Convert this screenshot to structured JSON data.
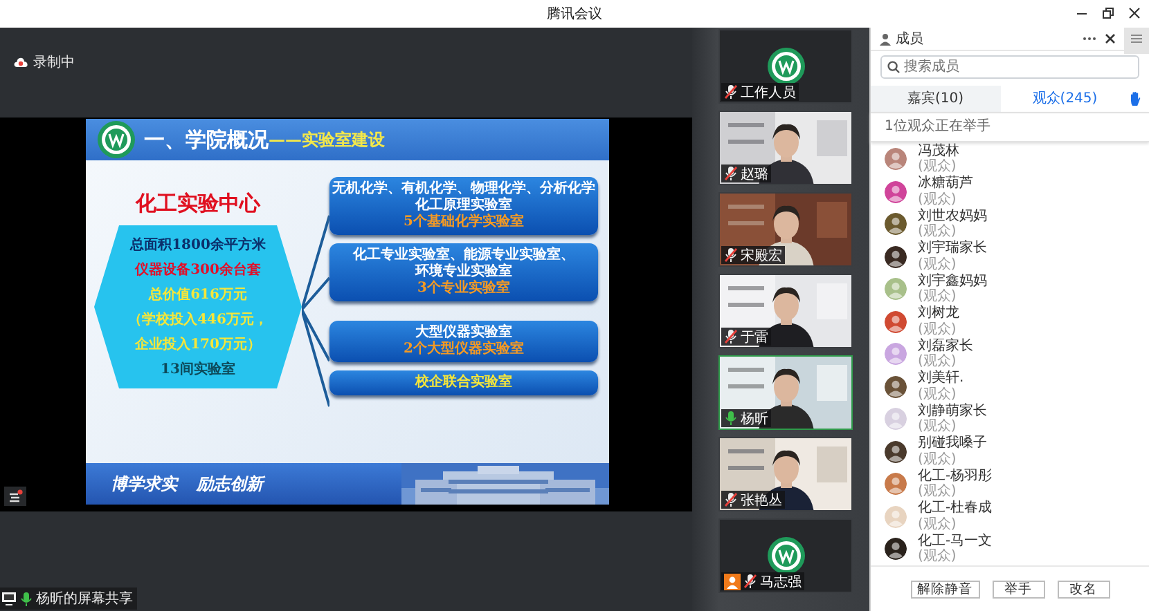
{
  "window": {
    "title": "腾讯会议"
  },
  "recording": {
    "label": "录制中"
  },
  "slide": {
    "title": "一、学院概况",
    "subtitle": "——实验室建设",
    "center_title": "化工实验中心",
    "summary": [
      {
        "text": "总面积1800余平方米",
        "color": "#0b2f6b"
      },
      {
        "text": "仪器设备300余台套",
        "color": "#e0102a"
      },
      {
        "text": "总价值616万元",
        "color": "#f5e63a"
      },
      {
        "text": "（学校投入446万元，",
        "color": "#f5e63a"
      },
      {
        "text": "企业投入170万元）",
        "color": "#f5e63a"
      },
      {
        "text": "13间实验室",
        "color": "#0d4a5a"
      }
    ],
    "labs": [
      {
        "lines": [
          {
            "text": "无机化学、有机化学、物理化学、分析化学",
            "color": "#ffffff"
          },
          {
            "text": "化工原理实验室",
            "color": "#ffffff"
          },
          {
            "text": "5个基础化学实验室",
            "color": "#f59a23"
          }
        ]
      },
      {
        "lines": [
          {
            "text": "化工专业实验室、能源专业实验室、",
            "color": "#ffffff"
          },
          {
            "text": "环境专业实验室",
            "color": "#ffffff"
          },
          {
            "text": "3个专业实验室",
            "color": "#f59a23"
          }
        ]
      },
      {
        "lines": [
          {
            "text": "大型仪器实验室",
            "color": "#ffffff"
          },
          {
            "text": "2个大型仪器实验室",
            "color": "#f59a23"
          }
        ]
      },
      {
        "lines": [
          {
            "text": "校企联合实验室",
            "color": "#f5e63a"
          }
        ]
      }
    ],
    "motto": [
      "博学求实",
      "励志创新"
    ]
  },
  "share_label": "杨昕的屏幕共享",
  "videos": [
    {
      "name": "工作人员",
      "kind": "logo",
      "muted": true,
      "active": false,
      "host": false
    },
    {
      "name": "赵璐",
      "kind": "picture",
      "muted": true,
      "active": false,
      "host": false
    },
    {
      "name": "宋殿宏",
      "kind": "picture",
      "muted": true,
      "active": false,
      "host": false
    },
    {
      "name": "于雷",
      "kind": "picture",
      "muted": true,
      "active": false,
      "host": false
    },
    {
      "name": "杨昕",
      "kind": "picture",
      "muted": false,
      "active": true,
      "host": false
    },
    {
      "name": "张艳丛",
      "kind": "picture",
      "muted": true,
      "active": false,
      "host": false
    },
    {
      "name": "马志强",
      "kind": "logo",
      "muted": true,
      "active": false,
      "host": true
    }
  ],
  "members": {
    "title": "成员",
    "search": {
      "placeholder": "搜索成员"
    },
    "tabs": [
      {
        "label": "嘉宾(10)",
        "selected": false
      },
      {
        "label": "观众(245)",
        "selected": true
      }
    ],
    "notice": "1位观众正在举手",
    "items": [
      {
        "name": "冯茂林",
        "role": "(观众)",
        "color": "#b9857a"
      },
      {
        "name": "冰糖葫芦",
        "role": "(观众)",
        "color": "#d0449a"
      },
      {
        "name": "刘世农妈妈",
        "role": "(观众)",
        "color": "#6b5a2e"
      },
      {
        "name": "刘宇瑞家长",
        "role": "(观众)",
        "color": "#3a2a22"
      },
      {
        "name": "刘宇鑫妈妈",
        "role": "(观众)",
        "color": "#a8c08a"
      },
      {
        "name": "刘树龙",
        "role": "(观众)",
        "color": "#d04a32"
      },
      {
        "name": "刘磊家长",
        "role": "(观众)",
        "color": "#c9a6e0"
      },
      {
        "name": "刘美轩.",
        "role": "(观众)",
        "color": "#6a5238"
      },
      {
        "name": "刘静萌家长",
        "role": "(观众)",
        "color": "#d8d0e0"
      },
      {
        "name": "别碰我嗓子",
        "role": "(观众)",
        "color": "#4a3a2c"
      },
      {
        "name": "化工-杨羽彤",
        "role": "(观众)",
        "color": "#c87a4a"
      },
      {
        "name": "化工-杜春成",
        "role": "(观众)",
        "color": "#e8d4c0"
      },
      {
        "name": "化工-马一文",
        "role": "(观众)",
        "color": "#2a221c"
      }
    ],
    "buttons": [
      "解除静音",
      "举手",
      "改名"
    ]
  }
}
